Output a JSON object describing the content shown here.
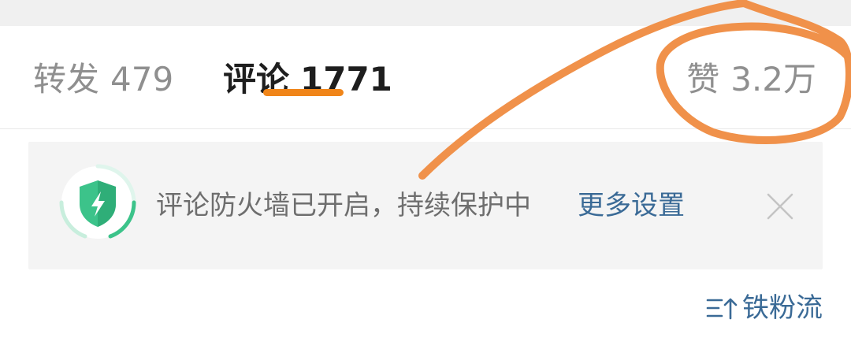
{
  "tabs": {
    "repost": {
      "label": "转发",
      "count": "479"
    },
    "comments": {
      "label": "评论",
      "count": "1771"
    },
    "likes": {
      "label": "赞",
      "count": "3.2万"
    }
  },
  "notice": {
    "text": "评论防火墙已开启，持续保护中",
    "link": "更多设置",
    "icon": "shield-lightning-icon",
    "close_icon": "close-icon"
  },
  "sort": {
    "label": "铁粉流",
    "icon": "sort-icon"
  },
  "colors": {
    "accent": "#f08519",
    "link": "#3a6a96",
    "annotation": "#f0914a",
    "shield": "#3cc38a"
  }
}
